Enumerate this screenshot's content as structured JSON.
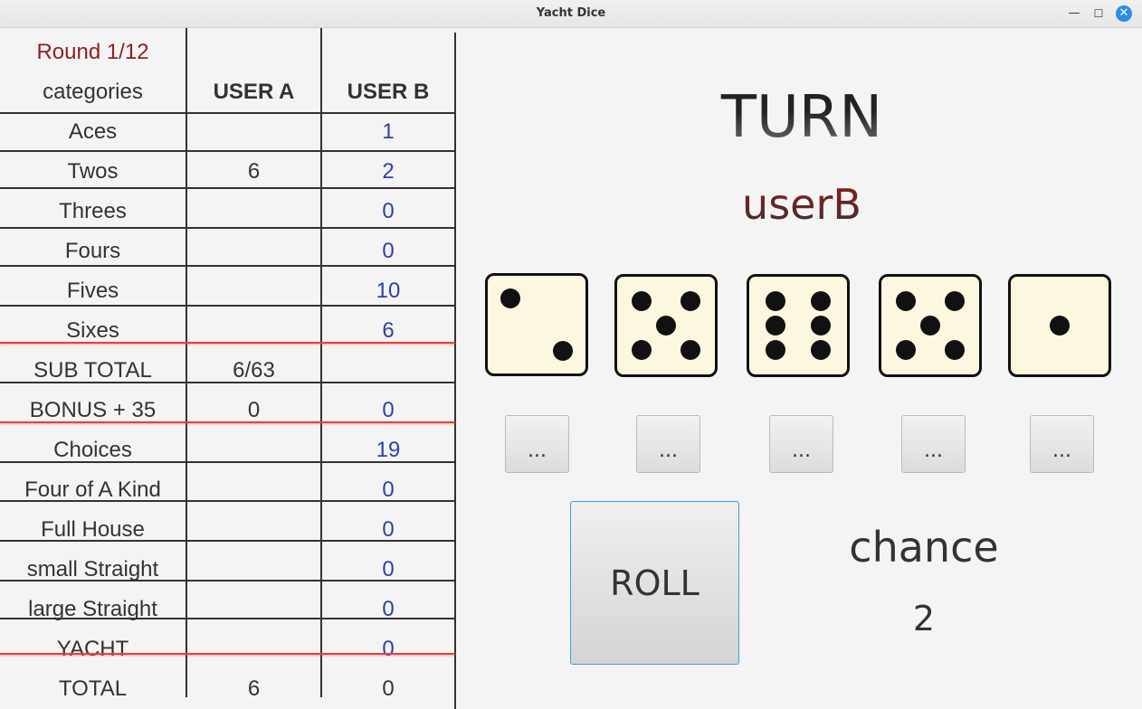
{
  "window": {
    "title": "Yacht Dice",
    "min_glyph": "—",
    "max_glyph": "☐",
    "close_glyph": "✕"
  },
  "scoreboard": {
    "round": "Round 1/12",
    "headers": {
      "category": "categories",
      "user_a": "USER A",
      "user_b": "USER B"
    },
    "rows": [
      {
        "category": "Aces",
        "user_a": "",
        "user_b": "1"
      },
      {
        "category": "Twos",
        "user_a": "6",
        "user_b": "2"
      },
      {
        "category": "Threes",
        "user_a": "",
        "user_b": "0"
      },
      {
        "category": "Fours",
        "user_a": "",
        "user_b": "0"
      },
      {
        "category": "Fives",
        "user_a": "",
        "user_b": "10"
      },
      {
        "category": "Sixes",
        "user_a": "",
        "user_b": "6"
      },
      {
        "category": "SUB TOTAL",
        "user_a": "6/63",
        "user_b": ""
      },
      {
        "category": "BONUS + 35",
        "user_a": "0",
        "user_b": "0"
      },
      {
        "category": "Choices",
        "user_a": "",
        "user_b": "19"
      },
      {
        "category": "Four of A Kind",
        "user_a": "",
        "user_b": "0"
      },
      {
        "category": "Full House",
        "user_a": "",
        "user_b": "0"
      },
      {
        "category": "small Straight",
        "user_a": "",
        "user_b": "0"
      },
      {
        "category": "large Straight",
        "user_a": "",
        "user_b": "0"
      },
      {
        "category": "YACHT",
        "user_a": "",
        "user_b": "0"
      },
      {
        "category": "TOTAL",
        "user_a": "6",
        "user_b": "0"
      }
    ]
  },
  "turn": {
    "label": "TURN",
    "player": "userB"
  },
  "dice": [
    2,
    5,
    6,
    5,
    1
  ],
  "hold_buttons": [
    "...",
    "...",
    "...",
    "...",
    "..."
  ],
  "roll_button": "ROLL",
  "chance": {
    "label": "chance",
    "value": "2"
  }
}
